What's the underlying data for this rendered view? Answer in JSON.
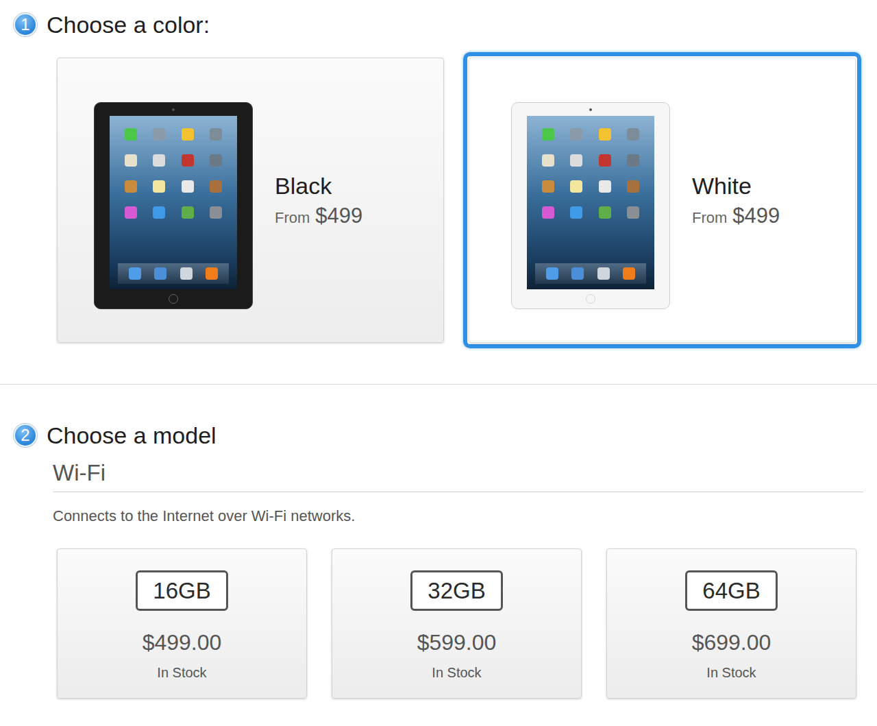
{
  "steps": [
    {
      "number": "1",
      "title": "Choose a color:"
    },
    {
      "number": "2",
      "title": "Choose a model"
    }
  ],
  "colors": [
    {
      "name": "Black",
      "from": "From",
      "price": "$499",
      "selected": false,
      "color": "#1b1b1b"
    },
    {
      "name": "White",
      "from": "From",
      "price": "$499",
      "selected": true,
      "color": "#f6f6f6"
    }
  ],
  "model_group": {
    "title": "Wi-Fi",
    "description": "Connects to the Internet over Wi-Fi networks."
  },
  "models": [
    {
      "capacity": "16GB",
      "price": "$499.00",
      "availability": "In Stock"
    },
    {
      "capacity": "32GB",
      "price": "$599.00",
      "availability": "In Stock"
    },
    {
      "capacity": "64GB",
      "price": "$699.00",
      "availability": "In Stock"
    }
  ]
}
